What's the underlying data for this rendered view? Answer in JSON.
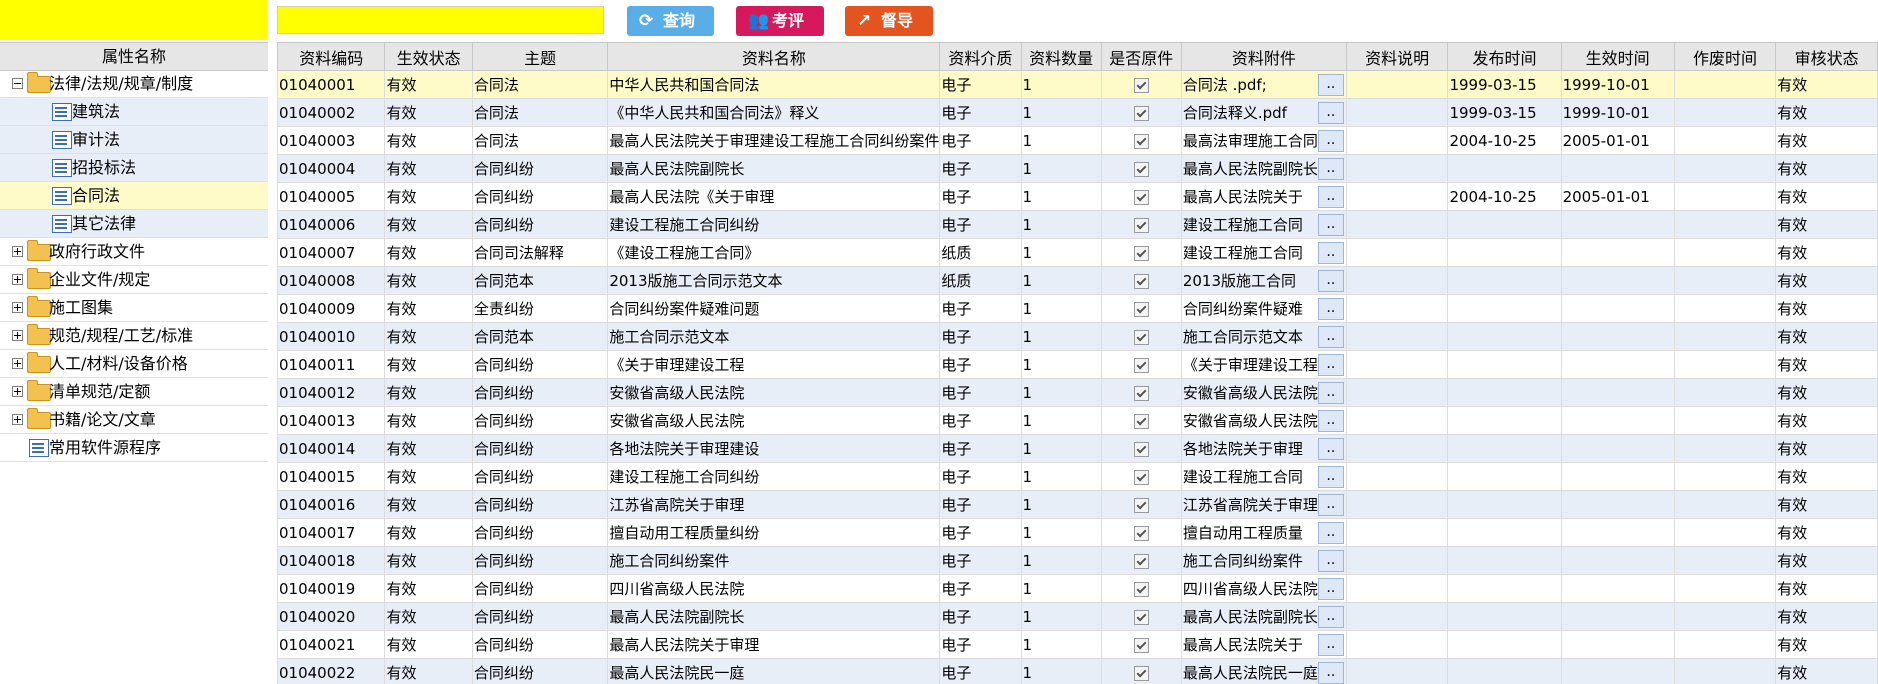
{
  "left": {
    "header": "属性名称",
    "tree": [
      {
        "label": "法律/法规/规章/制度",
        "type": "folder",
        "expanded": true,
        "level": 0
      },
      {
        "label": "建筑法",
        "type": "doc",
        "level": 1
      },
      {
        "label": "审计法",
        "type": "doc",
        "level": 1
      },
      {
        "label": "招投标法",
        "type": "doc",
        "level": 1
      },
      {
        "label": "合同法",
        "type": "doc",
        "level": 1,
        "selected": true
      },
      {
        "label": "其它法律",
        "type": "doc",
        "level": 1
      },
      {
        "label": "政府行政文件",
        "type": "folder",
        "expanded": false,
        "level": 0
      },
      {
        "label": "企业文件/规定",
        "type": "folder",
        "expanded": false,
        "level": 0
      },
      {
        "label": "施工图集",
        "type": "folder",
        "expanded": false,
        "level": 0
      },
      {
        "label": "规范/规程/工艺/标准",
        "type": "folder",
        "expanded": false,
        "level": 0
      },
      {
        "label": "人工/材料/设备价格",
        "type": "folder",
        "expanded": false,
        "level": 0
      },
      {
        "label": "清单规范/定额",
        "type": "folder",
        "expanded": false,
        "level": 0
      },
      {
        "label": "书籍/论文/文章",
        "type": "folder",
        "expanded": false,
        "level": 0
      },
      {
        "label": "常用软件源程序",
        "type": "doc",
        "level": 0
      }
    ]
  },
  "toolbar": {
    "query_label": "查询",
    "eval_label": "考评",
    "supervise_label": "督导"
  },
  "grid": {
    "columns": [
      "资料编码",
      "生效状态",
      "主题",
      "资料名称",
      "资料介质",
      "资料数量",
      "是否原件",
      "资料附件",
      "资料说明",
      "发布时间",
      "生效时间",
      "作废时间",
      "审核状态"
    ],
    "attach_button": "..",
    "rows": [
      {
        "code": "01040001",
        "status": "有效",
        "topic": "合同法",
        "name": "中华人民共和国合同法",
        "medium": "电子",
        "qty": "1",
        "attach": "合同法 .pdf;",
        "desc": "",
        "pub": "1999-03-15",
        "eff": "1999-10-01",
        "void": "",
        "audit": "有效",
        "selected": true
      },
      {
        "code": "01040002",
        "status": "有效",
        "topic": "合同法",
        "name": "《中华人民共和国合同法》释义",
        "medium": "电子",
        "qty": "1",
        "attach": "合同法释义.pdf",
        "desc": "",
        "pub": "1999-03-15",
        "eff": "1999-10-01",
        "void": "",
        "audit": "有效"
      },
      {
        "code": "01040003",
        "status": "有效",
        "topic": "合同法",
        "name": "最高人民法院关于审理建设工程施工合同纠纷案件",
        "medium": "电子",
        "qty": "1",
        "attach": "最高法审理施工合同",
        "desc": "",
        "pub": "2004-10-25",
        "eff": "2005-01-01",
        "void": "",
        "audit": "有效"
      },
      {
        "code": "01040004",
        "status": "有效",
        "topic": "合同纠纷",
        "name": "最高人民法院副院长",
        "medium": "电子",
        "qty": "1",
        "attach": "最高人民法院副院长",
        "desc": "",
        "pub": "",
        "eff": "",
        "void": "",
        "audit": "有效"
      },
      {
        "code": "01040005",
        "status": "有效",
        "topic": "合同纠纷",
        "name": "最高人民法院《关于审理",
        "medium": "电子",
        "qty": "1",
        "attach": "最高人民法院关于",
        "desc": "",
        "pub": "2004-10-25",
        "eff": "2005-01-01",
        "void": "",
        "audit": "有效"
      },
      {
        "code": "01040006",
        "status": "有效",
        "topic": "合同纠纷",
        "name": "建设工程施工合同纠纷",
        "medium": "电子",
        "qty": "1",
        "attach": "建设工程施工合同",
        "desc": "",
        "pub": "",
        "eff": "",
        "void": "",
        "audit": "有效"
      },
      {
        "code": "01040007",
        "status": "有效",
        "topic": "合同司法解释",
        "name": "《建设工程施工合同》",
        "medium": "纸质",
        "qty": "1",
        "attach": "建设工程施工合同",
        "desc": "",
        "pub": "",
        "eff": "",
        "void": "",
        "audit": "有效"
      },
      {
        "code": "01040008",
        "status": "有效",
        "topic": "合同范本",
        "name": "2013版施工合同示范文本",
        "medium": "纸质",
        "qty": "1",
        "attach": "2013版施工合同",
        "desc": "",
        "pub": "",
        "eff": "",
        "void": "",
        "audit": "有效"
      },
      {
        "code": "01040009",
        "status": "有效",
        "topic": "全责纠纷",
        "name": "合同纠纷案件疑难问题",
        "medium": "电子",
        "qty": "1",
        "attach": "合同纠纷案件疑难",
        "desc": "",
        "pub": "",
        "eff": "",
        "void": "",
        "audit": "有效"
      },
      {
        "code": "01040010",
        "status": "有效",
        "topic": "合同范本",
        "name": "施工合同示范文本",
        "medium": "电子",
        "qty": "1",
        "attach": "施工合同示范文本",
        "desc": "",
        "pub": "",
        "eff": "",
        "void": "",
        "audit": "有效"
      },
      {
        "code": "01040011",
        "status": "有效",
        "topic": "合同纠纷",
        "name": "《关于审理建设工程",
        "medium": "电子",
        "qty": "1",
        "attach": "《关于审理建设工程",
        "desc": "",
        "pub": "",
        "eff": "",
        "void": "",
        "audit": "有效"
      },
      {
        "code": "01040012",
        "status": "有效",
        "topic": "合同纠纷",
        "name": "安徽省高级人民法院",
        "medium": "电子",
        "qty": "1",
        "attach": "安徽省高级人民法院",
        "desc": "",
        "pub": "",
        "eff": "",
        "void": "",
        "audit": "有效"
      },
      {
        "code": "01040013",
        "status": "有效",
        "topic": "合同纠纷",
        "name": "安徽省高级人民法院",
        "medium": "电子",
        "qty": "1",
        "attach": "安徽省高级人民法院",
        "desc": "",
        "pub": "",
        "eff": "",
        "void": "",
        "audit": "有效"
      },
      {
        "code": "01040014",
        "status": "有效",
        "topic": "合同纠纷",
        "name": "各地法院关于审理建设",
        "medium": "电子",
        "qty": "1",
        "attach": "各地法院关于审理",
        "desc": "",
        "pub": "",
        "eff": "",
        "void": "",
        "audit": "有效"
      },
      {
        "code": "01040015",
        "status": "有效",
        "topic": "合同纠纷",
        "name": "建设工程施工合同纠纷",
        "medium": "电子",
        "qty": "1",
        "attach": "建设工程施工合同",
        "desc": "",
        "pub": "",
        "eff": "",
        "void": "",
        "audit": "有效"
      },
      {
        "code": "01040016",
        "status": "有效",
        "topic": "合同纠纷",
        "name": "江苏省高院关于审理",
        "medium": "电子",
        "qty": "1",
        "attach": "江苏省高院关于审理",
        "desc": "",
        "pub": "",
        "eff": "",
        "void": "",
        "audit": "有效"
      },
      {
        "code": "01040017",
        "status": "有效",
        "topic": "合同纠纷",
        "name": "擅自动用工程质量纠纷",
        "medium": "电子",
        "qty": "1",
        "attach": "擅自动用工程质量",
        "desc": "",
        "pub": "",
        "eff": "",
        "void": "",
        "audit": "有效"
      },
      {
        "code": "01040018",
        "status": "有效",
        "topic": "合同纠纷",
        "name": "施工合同纠纷案件",
        "medium": "电子",
        "qty": "1",
        "attach": "施工合同纠纷案件",
        "desc": "",
        "pub": "",
        "eff": "",
        "void": "",
        "audit": "有效"
      },
      {
        "code": "01040019",
        "status": "有效",
        "topic": "合同纠纷",
        "name": "四川省高级人民法院",
        "medium": "电子",
        "qty": "1",
        "attach": "四川省高级人民法院",
        "desc": "",
        "pub": "",
        "eff": "",
        "void": "",
        "audit": "有效"
      },
      {
        "code": "01040020",
        "status": "有效",
        "topic": "合同纠纷",
        "name": "最高人民法院副院长",
        "medium": "电子",
        "qty": "1",
        "attach": "最高人民法院副院长",
        "desc": "",
        "pub": "",
        "eff": "",
        "void": "",
        "audit": "有效"
      },
      {
        "code": "01040021",
        "status": "有效",
        "topic": "合同纠纷",
        "name": "最高人民法院关于审理",
        "medium": "电子",
        "qty": "1",
        "attach": "最高人民法院关于",
        "desc": "",
        "pub": "",
        "eff": "",
        "void": "",
        "audit": "有效"
      },
      {
        "code": "01040022",
        "status": "有效",
        "topic": "合同纠纷",
        "name": "最高人民法院民一庭",
        "medium": "电子",
        "qty": "1",
        "attach": "最高人民法院民一庭",
        "desc": "",
        "pub": "",
        "eff": "",
        "void": "",
        "audit": "有效"
      }
    ]
  }
}
